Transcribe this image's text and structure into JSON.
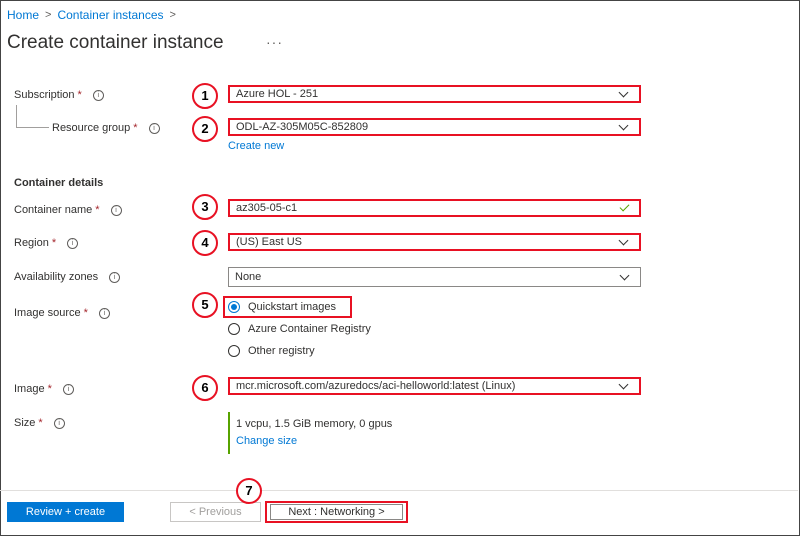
{
  "breadcrumb": {
    "home": "Home",
    "container_instances": "Container instances",
    "sep": ">"
  },
  "page": {
    "title": "Create container instance",
    "more": "···"
  },
  "labels": {
    "subscription": "Subscription",
    "resource_group": "Resource group",
    "container_details": "Container details",
    "container_name": "Container name",
    "region": "Region",
    "availability_zones": "Availability zones",
    "image_source": "Image source",
    "image": "Image",
    "size": "Size",
    "required": "*",
    "info": "i"
  },
  "fields": {
    "subscription": "Azure HOL - 251",
    "resource_group": "ODL-AZ-305M05C-852809",
    "create_new": "Create new",
    "container_name": "az305-05-c1",
    "region": "(US) East US",
    "availability_zones": "None",
    "image": "mcr.microsoft.com/azuredocs/aci-helloworld:latest (Linux)"
  },
  "image_source_options": [
    "Quickstart images",
    "Azure Container Registry",
    "Other registry"
  ],
  "size": {
    "value": "1 vcpu, 1.5 GiB memory, 0 gpus",
    "change": "Change size"
  },
  "buttons": {
    "review_create": "Review + create",
    "previous": "< Previous",
    "next": "Next : Networking >"
  },
  "badges": [
    "1",
    "2",
    "3",
    "4",
    "5",
    "6",
    "7"
  ],
  "colors": {
    "accent": "#0078d4",
    "highlight": "#e81123",
    "success": "#57a300",
    "required": "#a4262c"
  }
}
